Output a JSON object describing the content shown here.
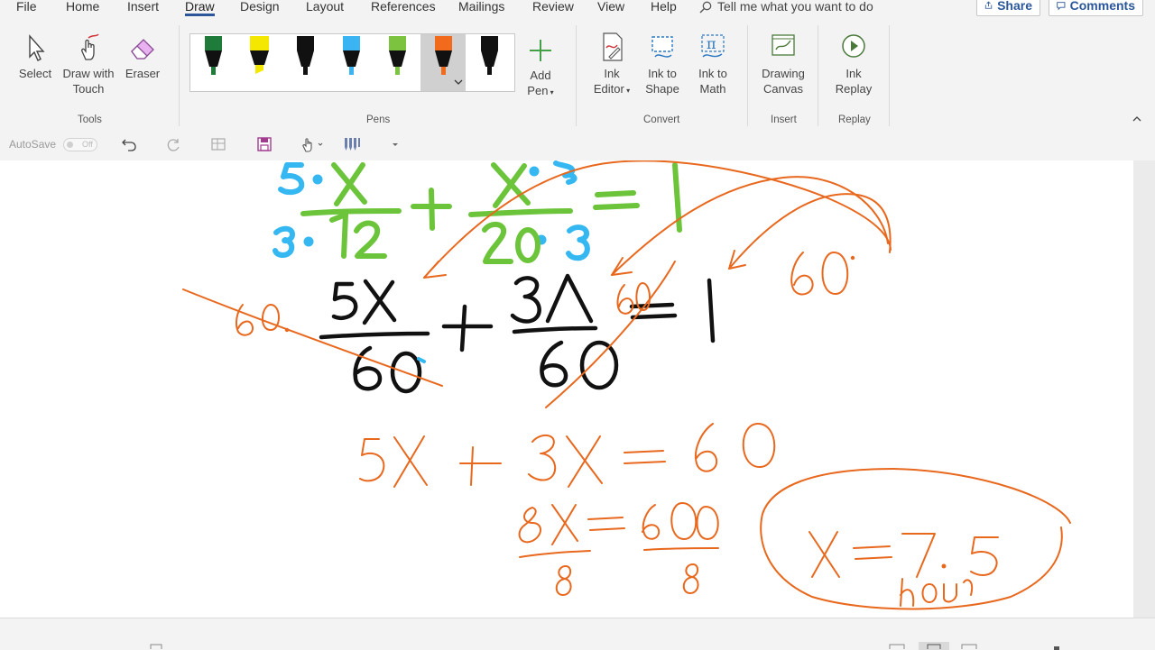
{
  "tabs": [
    "File",
    "Home",
    "Insert",
    "Draw",
    "Design",
    "Layout",
    "References",
    "Mailings",
    "Review",
    "View",
    "Help"
  ],
  "active_tab": "Draw",
  "tell_me": "Tell me what you want to do",
  "share_label": "Share",
  "comments_label": "Comments",
  "tools": {
    "select": "Select",
    "draw_touch_1": "Draw with",
    "draw_touch_2": "Touch",
    "eraser": "Eraser",
    "group": "Tools"
  },
  "pens": {
    "group": "Pens",
    "colors": [
      "#1e7b3a",
      "#f5e800",
      "#111111",
      "#3ab4f2",
      "#7cc33f",
      "#f26b1d",
      "#111111"
    ],
    "selected_index": 5
  },
  "add_pen": {
    "line1": "Add",
    "line2": "Pen"
  },
  "convert": {
    "group": "Convert",
    "ink_editor_1": "Ink",
    "ink_editor_2": "Editor",
    "ink_shape_1": "Ink to",
    "ink_shape_2": "Shape",
    "ink_math_1": "Ink to",
    "ink_math_2": "Math"
  },
  "insert": {
    "group": "Insert",
    "canvas_1": "Drawing",
    "canvas_2": "Canvas"
  },
  "replay": {
    "group": "Replay",
    "ink_replay_1": "Ink",
    "ink_replay_2": "Replay"
  },
  "qat": {
    "autosave": "AutoSave",
    "autosave_state": "Off"
  },
  "ink_colors": {
    "blue": "#35b8f2",
    "green": "#6cc43a",
    "black": "#111111",
    "orange": "#e8681e"
  }
}
